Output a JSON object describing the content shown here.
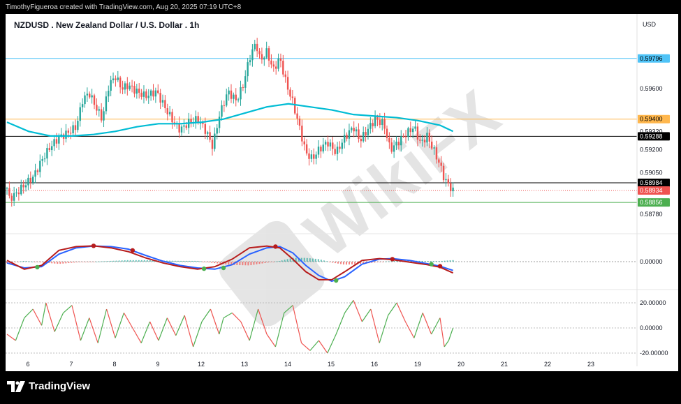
{
  "header": {
    "credit": "TimothyFigueroa created with TradingView.com, Aug 20, 2025 07:19 UTC+8",
    "symbol_title": "NZDUSD . New Zealand Dollar / U.S. Dollar . 1h",
    "currency": "USD"
  },
  "footer": {
    "brand": "TradingView"
  },
  "watermark": "WikiFX",
  "colors": {
    "up": "#26a69a",
    "down": "#ef5350",
    "ma": "#00bcd4",
    "line_blue": "#4fc3f7",
    "line_orange": "#ffb74d",
    "line_black": "#000000",
    "line_green": "#4caf50",
    "macd_blue": "#2962ff",
    "macd_red": "#b71c1c",
    "rsi_up": "#4caf50",
    "rsi_down": "#ef5350"
  },
  "chart_data": [
    {
      "type": "candlestick",
      "symbol": "NZDUSD",
      "interval": "1h",
      "x_ticks": [
        "6",
        "7",
        "8",
        "9",
        "12",
        "13",
        "14",
        "15",
        "16",
        "19",
        "20",
        "21",
        "22",
        "23"
      ],
      "y_ticks": [
        0.596,
        0.5932,
        0.592,
        0.5905,
        0.5878
      ],
      "ylim": [
        0.5872,
        0.5995
      ],
      "horizontal_lines": [
        {
          "value": 0.59796,
          "label": "0.59796",
          "color": "#4fc3f7"
        },
        {
          "value": 0.594,
          "label": "0.59400",
          "color": "#ffb74d"
        },
        {
          "value": 0.59288,
          "label": "0.59288",
          "color": "#000000"
        },
        {
          "value": 0.58984,
          "label": "0.58984",
          "color": "#000000"
        },
        {
          "value": 0.58856,
          "label": "0.58856",
          "color": "#4caf50"
        }
      ],
      "last_price": {
        "value": 0.58934,
        "label": "0.58934"
      },
      "close_path": [
        [
          0,
          0.5895
        ],
        [
          0.05,
          0.5888
        ],
        [
          0.2,
          0.5891
        ],
        [
          0.4,
          0.5897
        ],
        [
          0.6,
          0.5902
        ],
        [
          0.8,
          0.5913
        ],
        [
          1.0,
          0.5922
        ],
        [
          1.2,
          0.5928
        ],
        [
          1.4,
          0.5931
        ],
        [
          1.6,
          0.5935
        ],
        [
          1.75,
          0.5953
        ],
        [
          1.9,
          0.5957
        ],
        [
          2.05,
          0.5948
        ],
        [
          2.2,
          0.594
        ],
        [
          2.35,
          0.5962
        ],
        [
          2.5,
          0.5968
        ],
        [
          2.65,
          0.596
        ],
        [
          2.8,
          0.5962
        ],
        [
          3.0,
          0.5958
        ],
        [
          3.2,
          0.5955
        ],
        [
          3.45,
          0.5958
        ],
        [
          3.7,
          0.5945
        ],
        [
          3.85,
          0.5938
        ],
        [
          4.0,
          0.5933
        ],
        [
          4.2,
          0.5938
        ],
        [
          4.4,
          0.594
        ],
        [
          4.6,
          0.5932
        ],
        [
          4.75,
          0.5922
        ],
        [
          4.9,
          0.5942
        ],
        [
          5.1,
          0.5958
        ],
        [
          5.3,
          0.5952
        ],
        [
          5.45,
          0.5962
        ],
        [
          5.6,
          0.598
        ],
        [
          5.75,
          0.599
        ],
        [
          5.85,
          0.5978
        ],
        [
          6.0,
          0.5984
        ],
        [
          6.15,
          0.5972
        ],
        [
          6.3,
          0.598
        ],
        [
          6.45,
          0.5963
        ],
        [
          6.6,
          0.5951
        ],
        [
          6.75,
          0.5935
        ],
        [
          6.9,
          0.5918
        ],
        [
          7.05,
          0.5914
        ],
        [
          7.2,
          0.592
        ],
        [
          7.4,
          0.5925
        ],
        [
          7.6,
          0.5918
        ],
        [
          7.8,
          0.5928
        ],
        [
          8.0,
          0.5935
        ],
        [
          8.15,
          0.5926
        ],
        [
          8.3,
          0.5932
        ],
        [
          8.5,
          0.594
        ],
        [
          8.7,
          0.5937
        ],
        [
          8.85,
          0.592
        ],
        [
          9.0,
          0.5924
        ],
        [
          9.2,
          0.593
        ],
        [
          9.4,
          0.5935
        ],
        [
          9.55,
          0.5924
        ],
        [
          9.7,
          0.5929
        ],
        [
          9.85,
          0.592
        ],
        [
          10.0,
          0.591
        ],
        [
          10.1,
          0.5901
        ],
        [
          10.2,
          0.5897
        ],
        [
          10.3,
          0.5893
        ]
      ],
      "moving_average": [
        [
          0,
          0.5938
        ],
        [
          0.5,
          0.5932
        ],
        [
          1.0,
          0.5929
        ],
        [
          1.5,
          0.5929
        ],
        [
          2.0,
          0.593
        ],
        [
          2.5,
          0.5932
        ],
        [
          3.0,
          0.5935
        ],
        [
          3.5,
          0.5937
        ],
        [
          4.0,
          0.5937
        ],
        [
          4.5,
          0.5938
        ],
        [
          5.0,
          0.594
        ],
        [
          5.5,
          0.5944
        ],
        [
          6.0,
          0.5948
        ],
        [
          6.5,
          0.595
        ],
        [
          7.0,
          0.5948
        ],
        [
          7.5,
          0.5946
        ],
        [
          8.0,
          0.5943
        ],
        [
          8.5,
          0.5942
        ],
        [
          9.0,
          0.5941
        ],
        [
          9.5,
          0.5939
        ],
        [
          10.0,
          0.5936
        ],
        [
          10.3,
          0.5932
        ]
      ]
    },
    {
      "type": "line",
      "title": "",
      "y_ticks": [
        0.0
      ],
      "tick_labels": [
        "0.00000"
      ],
      "ylim": [
        -1,
        1
      ],
      "series": [
        {
          "color": "#2962ff",
          "values": [
            [
              0,
              -0.05
            ],
            [
              0.4,
              -0.25
            ],
            [
              0.8,
              -0.2
            ],
            [
              1.2,
              0.3
            ],
            [
              1.6,
              0.55
            ],
            [
              2.0,
              0.62
            ],
            [
              2.4,
              0.6
            ],
            [
              2.8,
              0.5
            ],
            [
              3.2,
              0.25
            ],
            [
              3.6,
              0.02
            ],
            [
              4.0,
              -0.15
            ],
            [
              4.4,
              -0.25
            ],
            [
              4.8,
              -0.3
            ],
            [
              5.2,
              -0.12
            ],
            [
              5.6,
              0.3
            ],
            [
              6.0,
              0.55
            ],
            [
              6.3,
              0.6
            ],
            [
              6.6,
              0.35
            ],
            [
              6.9,
              -0.15
            ],
            [
              7.2,
              -0.55
            ],
            [
              7.5,
              -0.78
            ],
            [
              7.8,
              -0.6
            ],
            [
              8.2,
              -0.1
            ],
            [
              8.6,
              0.1
            ],
            [
              8.9,
              0.12
            ],
            [
              9.3,
              0.05
            ],
            [
              9.7,
              -0.08
            ],
            [
              10.0,
              -0.18
            ],
            [
              10.3,
              -0.35
            ]
          ]
        },
        {
          "color": "#b71c1c",
          "values": [
            [
              0,
              0.05
            ],
            [
              0.4,
              -0.3
            ],
            [
              0.8,
              -0.15
            ],
            [
              1.2,
              0.45
            ],
            [
              1.6,
              0.6
            ],
            [
              2.0,
              0.63
            ],
            [
              2.4,
              0.55
            ],
            [
              2.8,
              0.4
            ],
            [
              3.2,
              0.15
            ],
            [
              3.6,
              -0.05
            ],
            [
              4.0,
              -0.2
            ],
            [
              4.4,
              -0.3
            ],
            [
              4.8,
              -0.2
            ],
            [
              5.2,
              0.1
            ],
            [
              5.6,
              0.55
            ],
            [
              6.0,
              0.62
            ],
            [
              6.3,
              0.55
            ],
            [
              6.6,
              0.1
            ],
            [
              6.9,
              -0.4
            ],
            [
              7.2,
              -0.72
            ],
            [
              7.5,
              -0.72
            ],
            [
              7.8,
              -0.4
            ],
            [
              8.2,
              0.05
            ],
            [
              8.6,
              0.12
            ],
            [
              8.9,
              0.08
            ],
            [
              9.3,
              -0.02
            ],
            [
              9.7,
              -0.12
            ],
            [
              10.0,
              -0.22
            ],
            [
              10.3,
              -0.45
            ]
          ]
        }
      ],
      "signal_dots": [
        {
          "x": 0.7,
          "y": -0.22,
          "color": "#4caf50"
        },
        {
          "x": 2.0,
          "y": 0.63,
          "color": "#b71c1c"
        },
        {
          "x": 2.9,
          "y": 0.45,
          "color": "#b71c1c"
        },
        {
          "x": 4.55,
          "y": -0.28,
          "color": "#4caf50"
        },
        {
          "x": 5.0,
          "y": -0.25,
          "color": "#4caf50"
        },
        {
          "x": 6.2,
          "y": 0.6,
          "color": "#b71c1c"
        },
        {
          "x": 7.6,
          "y": -0.75,
          "color": "#4caf50"
        },
        {
          "x": 8.9,
          "y": 0.1,
          "color": "#b71c1c"
        },
        {
          "x": 9.8,
          "y": -0.1,
          "color": "#4caf50"
        },
        {
          "x": 10.0,
          "y": -0.18,
          "color": "#b71c1c"
        }
      ]
    },
    {
      "type": "line",
      "title": "",
      "y_ticks": [
        20,
        0,
        -20
      ],
      "tick_labels": [
        "20.00000",
        "0.00000",
        "-20.00000"
      ],
      "ylim": [
        -25,
        25
      ],
      "values": [
        [
          0,
          -5
        ],
        [
          0.2,
          -10
        ],
        [
          0.4,
          8
        ],
        [
          0.6,
          15
        ],
        [
          0.8,
          2
        ],
        [
          0.9,
          20
        ],
        [
          1.1,
          -3
        ],
        [
          1.3,
          12
        ],
        [
          1.5,
          18
        ],
        [
          1.7,
          -10
        ],
        [
          1.9,
          8
        ],
        [
          2.1,
          -12
        ],
        [
          2.3,
          15
        ],
        [
          2.5,
          -8
        ],
        [
          2.7,
          12
        ],
        [
          2.9,
          0
        ],
        [
          3.1,
          -12
        ],
        [
          3.3,
          5
        ],
        [
          3.5,
          -10
        ],
        [
          3.7,
          8
        ],
        [
          3.9,
          -6
        ],
        [
          4.1,
          10
        ],
        [
          4.3,
          -15
        ],
        [
          4.5,
          5
        ],
        [
          4.7,
          15
        ],
        [
          4.9,
          -5
        ],
        [
          5.0,
          8
        ],
        [
          5.2,
          12
        ],
        [
          5.4,
          5
        ],
        [
          5.6,
          -10
        ],
        [
          5.8,
          15
        ],
        [
          6.0,
          -5
        ],
        [
          6.2,
          -15
        ],
        [
          6.4,
          12
        ],
        [
          6.6,
          18
        ],
        [
          6.8,
          -12
        ],
        [
          7.0,
          -18
        ],
        [
          7.2,
          -10
        ],
        [
          7.4,
          -20
        ],
        [
          7.6,
          -5
        ],
        [
          7.8,
          12
        ],
        [
          8.0,
          22
        ],
        [
          8.2,
          5
        ],
        [
          8.4,
          15
        ],
        [
          8.6,
          -12
        ],
        [
          8.8,
          10
        ],
        [
          9.0,
          20
        ],
        [
          9.2,
          5
        ],
        [
          9.4,
          -8
        ],
        [
          9.6,
          12
        ],
        [
          9.8,
          -5
        ],
        [
          10.0,
          8
        ],
        [
          10.1,
          -15
        ],
        [
          10.2,
          -10
        ],
        [
          10.3,
          0
        ]
      ]
    }
  ]
}
